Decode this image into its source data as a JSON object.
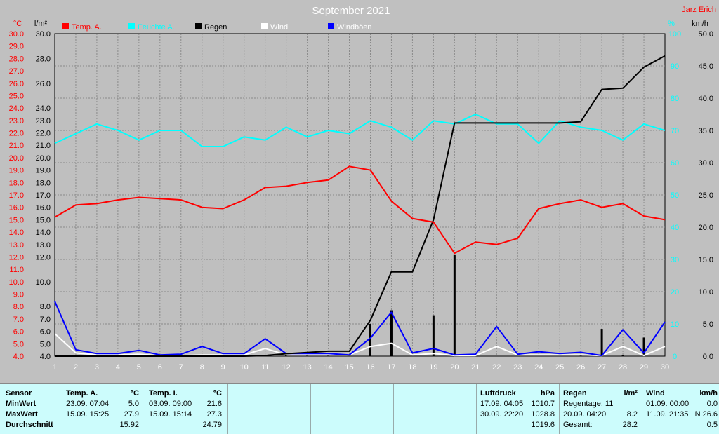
{
  "header": {
    "title": "September 2021",
    "author": "Jarz Erich"
  },
  "axis_units": {
    "temp": "°C",
    "rain": "l/m²",
    "humidity": "%",
    "wind": "km/h"
  },
  "legend": [
    {
      "label": "Temp. A.",
      "color": "#ff0000"
    },
    {
      "label": "Feuchte A.",
      "color": "#00ffff"
    },
    {
      "label": "Regen",
      "color": "#000000"
    },
    {
      "label": "Wind",
      "color": "#ffffff"
    },
    {
      "label": "Windböen",
      "color": "#0000ff"
    }
  ],
  "colors": {
    "background": "#c0c0c0",
    "plot_background": "#bfbfbf",
    "grid": "#8a8a8a",
    "temp": "#ff0000",
    "humidity": "#00ffff",
    "rain": "#000000",
    "wind": "#ffffff",
    "gust": "#0000ff",
    "panel": "#ccfcfc"
  },
  "chart_data": {
    "type": "line",
    "title": "September 2021",
    "grid": true,
    "legend_position": "top",
    "x": [
      1,
      2,
      3,
      4,
      5,
      6,
      7,
      8,
      9,
      10,
      11,
      12,
      13,
      14,
      15,
      16,
      17,
      18,
      19,
      20,
      21,
      22,
      23,
      24,
      25,
      26,
      27,
      28,
      29,
      30
    ],
    "axes": {
      "temp": {
        "min": 4.0,
        "max": 30.0,
        "ticks": [
          "4.0",
          "5.0",
          "6.0",
          "7.0",
          "8.0",
          "9.0",
          "10.0",
          "11.0",
          "12.0",
          "13.0",
          "14.0",
          "15.0",
          "16.0",
          "17.0",
          "18.0",
          "19.0",
          "20.0",
          "21.0",
          "22.0",
          "23.0",
          "24.0",
          "25.0",
          "26.0",
          "27.0",
          "28.0",
          "29.0",
          "30.0"
        ]
      },
      "rain": {
        "min": 4.0,
        "max": 30.0,
        "ticks": [
          "4.0",
          "5.0",
          "6.0",
          "7.0",
          "8.0",
          "10.0",
          "12.0",
          "13.0",
          "14.0",
          "15.0",
          "16.0",
          "17.0",
          "18.0",
          "19.0",
          "20.0",
          "21.0",
          "22.0",
          "23.0",
          "24.0",
          "26.0",
          "28.0",
          "30.0"
        ]
      },
      "humidity": {
        "min": 0,
        "max": 100,
        "ticks": [
          "0",
          "10",
          "20",
          "30",
          "40",
          "50",
          "60",
          "70",
          "80",
          "90",
          "100"
        ]
      },
      "wind": {
        "min": 0.0,
        "max": 50.0,
        "ticks": [
          "0.0",
          "5.0",
          "10.0",
          "15.0",
          "20.0",
          "25.0",
          "30.0",
          "35.0",
          "40.0",
          "45.0",
          "50.0"
        ]
      }
    },
    "series": [
      {
        "name": "Temp. A.",
        "axis": "temp",
        "color": "#ff0000",
        "values": [
          15.2,
          16.2,
          16.3,
          16.6,
          16.8,
          16.7,
          16.6,
          16.0,
          15.9,
          16.6,
          17.6,
          17.7,
          18.0,
          18.2,
          19.3,
          19.0,
          16.5,
          15.1,
          14.8,
          12.3,
          13.2,
          13.0,
          13.5,
          15.9,
          16.3,
          16.6,
          16.0,
          16.3,
          15.3,
          15.0
        ]
      },
      {
        "name": "Feuchte A.",
        "axis": "humidity",
        "color": "#00ffff",
        "values": [
          66,
          69,
          72,
          70,
          67,
          70,
          70,
          65,
          65,
          68,
          67,
          71,
          68,
          70,
          69,
          73,
          71,
          67,
          73,
          72,
          75,
          72,
          72,
          66,
          73,
          71,
          70,
          67,
          72,
          70
        ]
      },
      {
        "name": "Regen",
        "axis": "rain",
        "color": "#000000",
        "kind": "cumulative",
        "values": [
          4.0,
          4.0,
          4.0,
          4.0,
          4.0,
          4.0,
          4.0,
          4.0,
          4.0,
          4.0,
          4.05,
          4.2,
          4.3,
          4.4,
          4.4,
          6.9,
          10.8,
          10.8,
          15.0,
          22.8,
          22.8,
          22.8,
          22.8,
          22.8,
          22.8,
          22.9,
          25.5,
          25.6,
          27.3,
          28.2
        ]
      },
      {
        "name": "Regen (täglich)",
        "axis": "rain",
        "color": "#000000",
        "kind": "bars",
        "values": [
          0,
          0,
          0,
          0,
          0,
          0,
          0,
          0,
          0,
          0,
          0.05,
          0.15,
          0.1,
          0.1,
          0,
          2.6,
          3.7,
          0,
          3.3,
          8.2,
          0,
          0,
          0,
          0,
          0,
          0.1,
          2.2,
          0.1,
          1.5,
          0
        ]
      },
      {
        "name": "Wind",
        "axis": "wind",
        "color": "#ffffff",
        "values": [
          3.5,
          0.5,
          0.2,
          0.2,
          0.3,
          0.1,
          0.1,
          0.2,
          0.2,
          0.2,
          1.2,
          0.2,
          0.2,
          0.2,
          0.2,
          1.5,
          2.0,
          0.2,
          0.4,
          0.1,
          0.1,
          1.5,
          0.2,
          0.2,
          0.2,
          0.2,
          0.1,
          1.5,
          0.1,
          1.5
        ]
      },
      {
        "name": "Windböen",
        "axis": "wind",
        "color": "#0000ff",
        "values": [
          8.5,
          1.0,
          0.4,
          0.4,
          0.9,
          0.2,
          0.3,
          1.5,
          0.4,
          0.4,
          2.7,
          0.4,
          0.4,
          0.4,
          0.2,
          2.8,
          6.8,
          0.5,
          1.2,
          0.2,
          0.3,
          4.6,
          0.3,
          0.7,
          0.4,
          0.6,
          0.1,
          4.1,
          0.5,
          5.3
        ]
      }
    ]
  },
  "stats": {
    "row_labels": [
      "Sensor",
      "MinWert",
      "MaxWert",
      "Durchschnitt"
    ],
    "temp_a": {
      "title": "Temp. A.",
      "unit": "°C",
      "min_when": "23.09.  07:04",
      "min_val": "5.0",
      "max_when": "15.09.  15:25",
      "max_val": "27.9",
      "avg_val": "15.92"
    },
    "temp_i": {
      "title": "Temp. I.",
      "unit": "°C",
      "min_when": "03.09.  09:00",
      "min_val": "21.6",
      "max_when": "15.09.  15:14",
      "max_val": "27.3",
      "avg_val": "24.79"
    },
    "pressure": {
      "title": "Luftdruck",
      "unit": "hPa",
      "min_when": "17.09.  04:05",
      "min_val": "1010.7",
      "max_when": "30.09.  22:20",
      "max_val": "1028.8",
      "avg_val": "1019.6"
    },
    "rain": {
      "title": "Regen",
      "unit": "l/m²",
      "days_label": "Regentage: 11",
      "max_when": "20.09.  04:20",
      "max_val": "8.2",
      "total_label": "Gesamt:",
      "total_val": "28.2"
    },
    "wind": {
      "title": "Wind",
      "unit": "km/h",
      "min_when": "01.09.  00:00",
      "min_val": "0.0",
      "max_when": "11.09.  21:35",
      "max_val": "N 26.6",
      "avg_val": "0.5"
    }
  }
}
